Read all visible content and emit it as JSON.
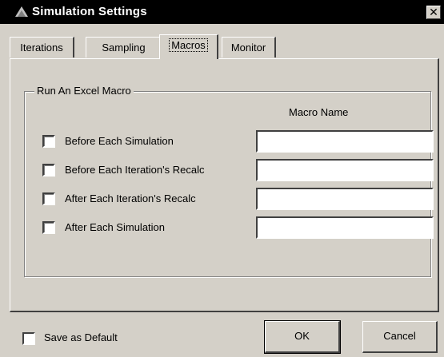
{
  "window": {
    "title": "Simulation Settings",
    "close_glyph": "✕",
    "icon": "application-icon"
  },
  "tabs": [
    {
      "label": "Iterations",
      "active": false
    },
    {
      "label": "Sampling",
      "active": false
    },
    {
      "label": "Macros",
      "active": true
    },
    {
      "label": "Monitor",
      "active": false
    }
  ],
  "group": {
    "label": "Run An Excel Macro",
    "column_header": "Macro Name",
    "rows": [
      {
        "label": "Before Each Simulation",
        "checked": false,
        "value": ""
      },
      {
        "label": "Before Each Iteration's Recalc",
        "checked": false,
        "value": ""
      },
      {
        "label": "After Each Iteration's Recalc",
        "checked": false,
        "value": ""
      },
      {
        "label": "After Each Simulation",
        "checked": false,
        "value": ""
      }
    ]
  },
  "footer": {
    "save_default_label": "Save as Default",
    "save_default_checked": false,
    "ok_label": "OK",
    "cancel_label": "Cancel"
  }
}
